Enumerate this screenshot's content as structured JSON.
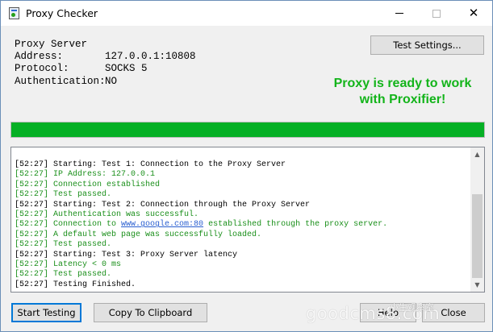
{
  "window": {
    "title": "Proxy Checker"
  },
  "info": {
    "header": "Proxy Server",
    "rows": [
      {
        "label": "Address:",
        "value": "127.0.0.1:10808"
      },
      {
        "label": "Protocol:",
        "value": "SOCKS 5"
      },
      {
        "label": "Authentication:",
        "value": "NO"
      }
    ]
  },
  "buttons": {
    "test_settings": "Test Settings...",
    "start_testing": "Start Testing",
    "copy_clipboard": "Copy To Clipboard",
    "help": "Help",
    "close": "Close"
  },
  "status": {
    "line1": "Proxy is ready to work",
    "line2": "with Proxifier!",
    "color": "#13b41a"
  },
  "progress": {
    "value": 1.0,
    "color": "#06b025"
  },
  "log": [
    {
      "color": "black",
      "prefix": "[52:27] Starting: Test 1: Connection to the Proxy Server"
    },
    {
      "color": "green",
      "prefix": "[52:27] IP Address: 127.0.0.1"
    },
    {
      "color": "green",
      "prefix": "[52:27] Connection established"
    },
    {
      "color": "green",
      "prefix": "[52:27] Test passed."
    },
    {
      "color": "black",
      "prefix": "[52:27] Starting: Test 2: Connection through the Proxy Server"
    },
    {
      "color": "green",
      "prefix": "[52:27] Authentication was successful."
    },
    {
      "color": "green",
      "prefix": "[52:27] Connection to ",
      "link": "www.google.com:80",
      "suffix": " established through the proxy server."
    },
    {
      "color": "green",
      "prefix": "[52:27] A default web page was successfully loaded."
    },
    {
      "color": "green",
      "prefix": "[52:27] Test passed."
    },
    {
      "color": "black",
      "prefix": "[52:27] Starting: Test 3: Proxy Server latency"
    },
    {
      "color": "green",
      "prefix": "[52:27] Latency < 0 ms"
    },
    {
      "color": "green",
      "prefix": "[52:27] Test passed."
    },
    {
      "color": "black",
      "prefix": "[52:27] Testing Finished."
    }
  ],
  "watermark": {
    "text": "goodcms8.com",
    "sub": "小生观察室"
  }
}
